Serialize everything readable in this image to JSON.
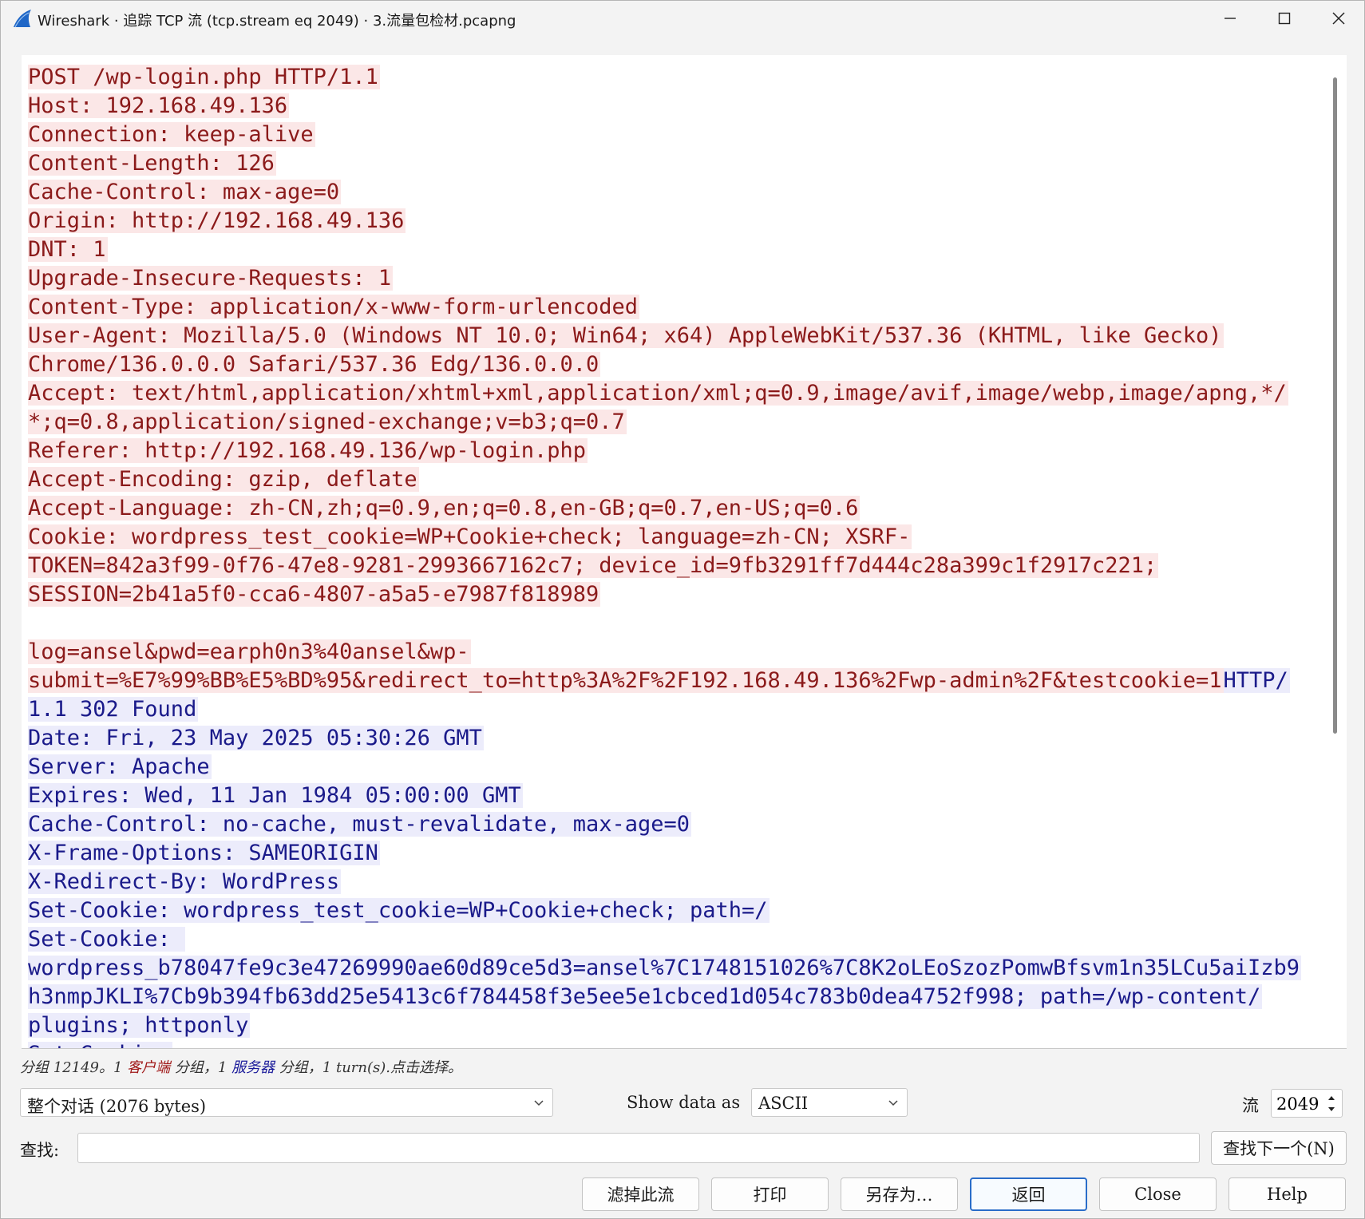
{
  "window": {
    "title": "Wireshark · 追踪 TCP 流 (tcp.stream eq 2049) · 3.流量包检材.pcapng"
  },
  "colors": {
    "client_text": "#8b1a1a",
    "client_bg": "#fbe7e7",
    "server_text": "#1a1a8a",
    "server_bg": "#ececfb"
  },
  "stream": {
    "lines": [
      [
        {
          "side": "client",
          "text": "POST /wp-login.php HTTP/1.1"
        }
      ],
      [
        {
          "side": "client",
          "text": "Host: 192.168.49.136"
        }
      ],
      [
        {
          "side": "client",
          "text": "Connection: keep-alive"
        }
      ],
      [
        {
          "side": "client",
          "text": "Content-Length: 126"
        }
      ],
      [
        {
          "side": "client",
          "text": "Cache-Control: max-age=0"
        }
      ],
      [
        {
          "side": "client",
          "text": "Origin: http://192.168.49.136"
        }
      ],
      [
        {
          "side": "client",
          "text": "DNT: 1"
        }
      ],
      [
        {
          "side": "client",
          "text": "Upgrade-Insecure-Requests: 1"
        }
      ],
      [
        {
          "side": "client",
          "text": "Content-Type: application/x-www-form-urlencoded"
        }
      ],
      [
        {
          "side": "client",
          "text": "User-Agent: Mozilla/5.0 (Windows NT 10.0; Win64; x64) AppleWebKit/537.36 (KHTML, like Gecko)"
        }
      ],
      [
        {
          "side": "client",
          "text": "Chrome/136.0.0.0 Safari/537.36 Edg/136.0.0.0"
        }
      ],
      [
        {
          "side": "client",
          "text": "Accept: text/html,application/xhtml+xml,application/xml;q=0.9,image/avif,image/webp,image/apng,*/"
        }
      ],
      [
        {
          "side": "client",
          "text": "*;q=0.8,application/signed-exchange;v=b3;q=0.7"
        }
      ],
      [
        {
          "side": "client",
          "text": "Referer: http://192.168.49.136/wp-login.php"
        }
      ],
      [
        {
          "side": "client",
          "text": "Accept-Encoding: gzip, deflate"
        }
      ],
      [
        {
          "side": "client",
          "text": "Accept-Language: zh-CN,zh;q=0.9,en;q=0.8,en-GB;q=0.7,en-US;q=0.6"
        }
      ],
      [
        {
          "side": "client",
          "text": "Cookie: wordpress_test_cookie=WP+Cookie+check; language=zh-CN; XSRF-"
        }
      ],
      [
        {
          "side": "client",
          "text": "TOKEN=842a3f99-0f76-47e8-9281-2993667162c7; device_id=9fb3291ff7d444c28a399c1f2917c221;"
        }
      ],
      [
        {
          "side": "client",
          "text": "SESSION=2b41a5f0-cca6-4807-a5a5-e7987f818989"
        }
      ],
      [],
      [
        {
          "side": "client",
          "text": "log=ansel&pwd=earph0n3%40ansel&wp-"
        }
      ],
      [
        {
          "side": "client",
          "text": "submit=%E7%99%BB%E5%BD%95&redirect_to=http%3A%2F%2F192.168.49.136%2Fwp-admin%2F&testcookie=1"
        },
        {
          "side": "server",
          "text": "HTTP/"
        }
      ],
      [
        {
          "side": "server",
          "text": "1.1 302 Found"
        }
      ],
      [
        {
          "side": "server",
          "text": "Date: Fri, 23 May 2025 05:30:26 GMT"
        }
      ],
      [
        {
          "side": "server",
          "text": "Server: Apache"
        }
      ],
      [
        {
          "side": "server",
          "text": "Expires: Wed, 11 Jan 1984 05:00:00 GMT"
        }
      ],
      [
        {
          "side": "server",
          "text": "Cache-Control: no-cache, must-revalidate, max-age=0"
        }
      ],
      [
        {
          "side": "server",
          "text": "X-Frame-Options: SAMEORIGIN"
        }
      ],
      [
        {
          "side": "server",
          "text": "X-Redirect-By: WordPress"
        }
      ],
      [
        {
          "side": "server",
          "text": "Set-Cookie: wordpress_test_cookie=WP+Cookie+check; path=/"
        }
      ],
      [
        {
          "side": "server",
          "text": "Set-Cookie: "
        }
      ],
      [
        {
          "side": "server",
          "text": "wordpress_b78047fe9c3e47269990ae60d89ce5d3=ansel%7C1748151026%7C8K2oLEoSzozPomwBfsvm1n35LCu5aiIzb9"
        }
      ],
      [
        {
          "side": "server",
          "text": "h3nmpJKLI%7Cb9b394fb63dd25e5413c6f784458f3e5ee5e1cbced1d054c783b0dea4752f998; path=/wp-content/"
        }
      ],
      [
        {
          "side": "server",
          "text": "plugins; httponly"
        }
      ],
      [
        {
          "side": "server",
          "text": "Set-Cookie:"
        }
      ]
    ]
  },
  "status": {
    "prefix": "分组 12149。1 ",
    "client_word": "客户端",
    "middle": " 分组，1 ",
    "server_word": "服务器",
    "suffix": " 分组，1 turn(s).点击选择。"
  },
  "controls": {
    "conversation_select": "整个对话 (2076 bytes)",
    "show_data_label": "Show data as",
    "show_data_select": "ASCII",
    "stream_label": "流",
    "stream_value": "2049",
    "find_label": "查找:",
    "find_value": "",
    "find_next_button": "查找下一个(N)"
  },
  "buttons": {
    "filter_out": "滤掉此流",
    "print": "打印",
    "save_as": "另存为…",
    "back": "返回",
    "close": "Close",
    "help": "Help"
  }
}
